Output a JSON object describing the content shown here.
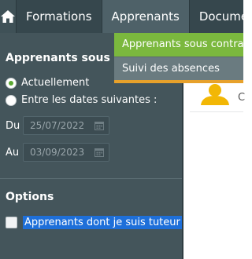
{
  "nav": {
    "home_icon": "home-icon",
    "tabs": [
      {
        "label": "Formations"
      },
      {
        "label": "Apprenants"
      },
      {
        "label": "Docume"
      }
    ]
  },
  "dropdown": {
    "items": [
      {
        "label": "Apprenants sous contrat"
      },
      {
        "label": "Suivi des absences"
      }
    ]
  },
  "filters": {
    "title": "Apprenants sous con",
    "radio_current": "Actuellement",
    "radio_range": "Entre les dates suivantes :",
    "du_label": "Du",
    "du_value": "25/07/2022",
    "au_label": "Au",
    "au_value": "03/09/2023",
    "calendar_icon": "calendar-icon"
  },
  "options": {
    "title": "Options",
    "tutor_checkbox_label": "Apprenants dont je suis tuteur"
  },
  "content": {
    "partial_text": "C",
    "icon": "user-icon"
  },
  "colors": {
    "nav_bg": "#36474d",
    "sidebar_bg": "#44555b",
    "accent_green": "#7bb83e",
    "accent_orange": "#e7a12b",
    "avatar_gold": "#f2b705",
    "selection_blue": "#1e6fd9"
  }
}
